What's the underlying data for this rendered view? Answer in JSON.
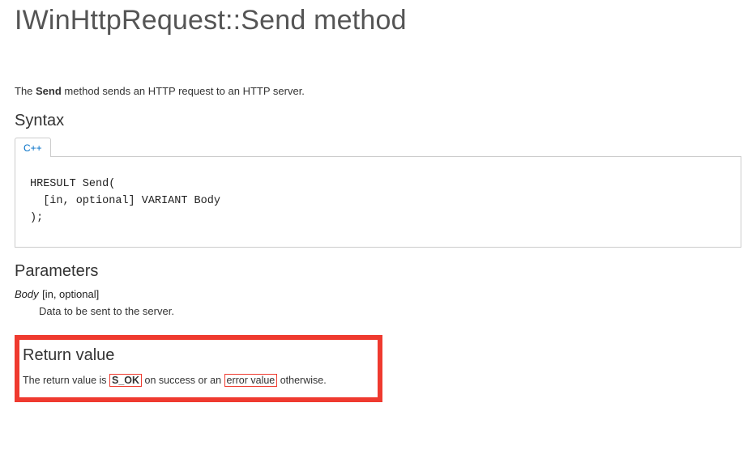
{
  "title": "IWinHttpRequest::Send method",
  "intro": {
    "prefix": "The ",
    "bold": "Send",
    "suffix": " method sends an HTTP request to an HTTP server."
  },
  "syntax": {
    "heading": "Syntax",
    "tab_label": "C++",
    "code": "HRESULT Send(\n  [in, optional] VARIANT Body\n);"
  },
  "parameters": {
    "heading": "Parameters",
    "items": [
      {
        "name": "Body",
        "attrs": "[in, optional]",
        "desc": "Data to be sent to the server."
      }
    ]
  },
  "return": {
    "heading": "Return value",
    "text_prefix": "The return value is ",
    "ok_token": "S_OK",
    "text_mid": " on success or an ",
    "err_token": "error value",
    "text_suffix": " otherwise."
  }
}
